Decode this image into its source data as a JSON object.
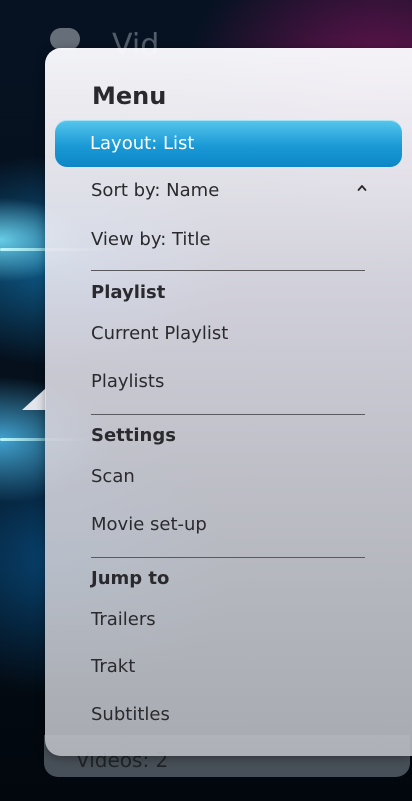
{
  "background": {
    "header_title": "Vid",
    "footer_text": "Videos: 2"
  },
  "menu": {
    "title": "Menu",
    "items": [
      {
        "label": "Layout: List",
        "selected": true
      },
      {
        "label": "Sort by: Name"
      },
      {
        "label": "View by: Title"
      }
    ],
    "sections": [
      {
        "title": "Playlist",
        "items": [
          "Current Playlist",
          "Playlists"
        ]
      },
      {
        "title": "Settings",
        "items": [
          "Scan",
          "Movie set-up"
        ]
      },
      {
        "title": "Jump to",
        "items": [
          "Trailers",
          "Trakt",
          "Subtitles"
        ]
      }
    ]
  },
  "colors": {
    "selected_item": "#1a9ad6",
    "text": "#2a2a2e"
  },
  "icons": {
    "sort_direction": "chevron-up-icon"
  }
}
